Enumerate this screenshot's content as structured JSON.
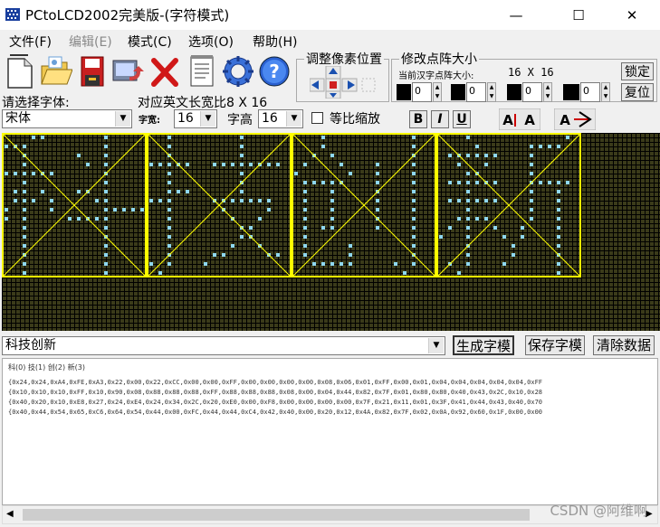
{
  "window": {
    "title": "PCtoLCD2002完美版-(字符模式)",
    "minimize": "—",
    "maximize": "☐",
    "close": "✕"
  },
  "menu": [
    {
      "label": "文件(F)",
      "disabled": false
    },
    {
      "label": "编辑(E)",
      "disabled": true
    },
    {
      "label": "模式(C)",
      "disabled": false
    },
    {
      "label": "选项(O)",
      "disabled": false
    },
    {
      "label": "帮助(H)",
      "disabled": false
    }
  ],
  "toolbar": {
    "icons": [
      "new-file-icon",
      "open-folder-icon",
      "save-icon",
      "export-icon",
      "delete-icon",
      "notepad-icon",
      "settings-gear-icon",
      "help-icon"
    ],
    "pixel_pos_group": "调整像素位置",
    "matrix_group": "修改点阵大小",
    "matrix_caption": "当前汉字点阵大小:",
    "matrix_size": "16 X 16",
    "lock_button": "锁定",
    "reset_button": "复位",
    "spin_values": [
      "0",
      "0",
      "0",
      "0"
    ]
  },
  "font_row": {
    "font_label": "请选择字体:",
    "ratio_label": "对应英文长宽比8 X 16",
    "font_value": "宋体",
    "width_label": "字宽:",
    "width_value": "16",
    "height_label": "字高",
    "height_value": "16",
    "scale_label": "等比缩放",
    "bold": "B",
    "italic": "I",
    "underline": "U"
  },
  "glyph_grid": {
    "cells": 4,
    "frame_color": "#ffff00",
    "pixel_on_color": "#8fd8f0",
    "background_color": "#3b3b1a"
  },
  "action_row": {
    "input_value": "科技创新",
    "generate_button": "生成字模",
    "save_button": "保存字模",
    "clear_button": "清除数据"
  },
  "output": {
    "header": "科(0) 技(1) 创(2) 新(3)",
    "lines": [
      "{0x24,0x24,0xA4,0xFE,0xA3,0x22,0x00,0x22,0xCC,0x00,0x00,0xFF,0x00,0x00,0x00,0x00,0x08,0x06,0x01,0xFF,0x00,0x01,0x04,0x04,0x04,0x04,0x04,0xFF",
      "{0x10,0x10,0x10,0xFF,0x10,0x90,0x08,0x88,0x88,0x88,0xFF,0x88,0x88,0x88,0x08,0x00,0x04,0x44,0x82,0x7F,0x01,0x80,0x80,0x40,0x43,0x2C,0x10,0x28",
      "{0x40,0x20,0x10,0xE8,0x27,0x24,0xE4,0x24,0x34,0x2C,0x20,0xE0,0x00,0xF8,0x00,0x00,0x00,0x00,0x7F,0x21,0x11,0x01,0x3F,0x41,0x44,0x43,0x40,0x70",
      "{0x40,0x44,0x54,0x65,0xC6,0x64,0x54,0x44,0x00,0xFC,0x44,0x44,0xC4,0x42,0x40,0x00,0x20,0x12,0x4A,0x82,0x7F,0x02,0x0A,0x92,0x60,0x1F,0x00,0x00"
    ]
  },
  "watermark": "CSDN @阿维啊"
}
